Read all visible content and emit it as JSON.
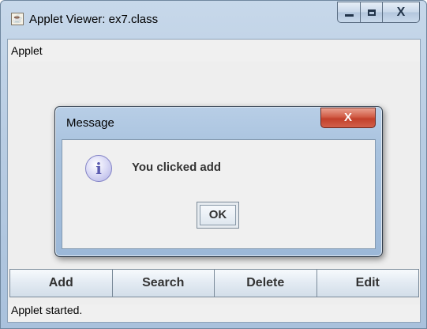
{
  "window": {
    "title": "Applet Viewer: ex7.class",
    "menu_label": "Applet",
    "status_text": "Applet started."
  },
  "icons": {
    "app": "java-cup-icon",
    "minimize": "minimize-icon",
    "maximize": "maximize-icon",
    "close": "close-icon",
    "info": "information-icon"
  },
  "buttons": [
    {
      "label": "Add"
    },
    {
      "label": "Search"
    },
    {
      "label": "Delete"
    },
    {
      "label": "Edit"
    }
  ],
  "dialog": {
    "title": "Message",
    "close_glyph": "X",
    "message": "You clicked add",
    "ok_label": "OK",
    "info_glyph": "i"
  },
  "colors": {
    "dialog_close": "#c2402b",
    "info_icon": "#5b5bb0"
  }
}
